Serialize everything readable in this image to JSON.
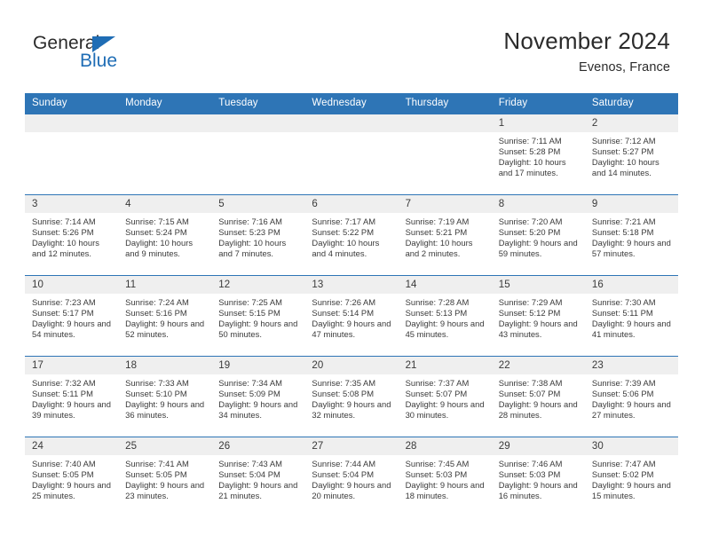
{
  "brand": {
    "name_part1": "General",
    "name_part2": "Blue",
    "logo_icon": "blue-triangle-icon"
  },
  "header": {
    "title": "November 2024",
    "location": "Evenos, France"
  },
  "colors": {
    "header_blue": "#2e75b6",
    "brand_blue": "#1f6db5",
    "daynum_band": "#efefef",
    "text": "#3a3a3a"
  },
  "weekday_headers": [
    "Sunday",
    "Monday",
    "Tuesday",
    "Wednesday",
    "Thursday",
    "Friday",
    "Saturday"
  ],
  "weeks": [
    [
      {
        "empty": true
      },
      {
        "empty": true
      },
      {
        "empty": true
      },
      {
        "empty": true
      },
      {
        "empty": true
      },
      {
        "day": "1",
        "sunrise": "Sunrise: 7:11 AM",
        "sunset": "Sunset: 5:28 PM",
        "daylight": "Daylight: 10 hours and 17 minutes."
      },
      {
        "day": "2",
        "sunrise": "Sunrise: 7:12 AM",
        "sunset": "Sunset: 5:27 PM",
        "daylight": "Daylight: 10 hours and 14 minutes."
      }
    ],
    [
      {
        "day": "3",
        "sunrise": "Sunrise: 7:14 AM",
        "sunset": "Sunset: 5:26 PM",
        "daylight": "Daylight: 10 hours and 12 minutes."
      },
      {
        "day": "4",
        "sunrise": "Sunrise: 7:15 AM",
        "sunset": "Sunset: 5:24 PM",
        "daylight": "Daylight: 10 hours and 9 minutes."
      },
      {
        "day": "5",
        "sunrise": "Sunrise: 7:16 AM",
        "sunset": "Sunset: 5:23 PM",
        "daylight": "Daylight: 10 hours and 7 minutes."
      },
      {
        "day": "6",
        "sunrise": "Sunrise: 7:17 AM",
        "sunset": "Sunset: 5:22 PM",
        "daylight": "Daylight: 10 hours and 4 minutes."
      },
      {
        "day": "7",
        "sunrise": "Sunrise: 7:19 AM",
        "sunset": "Sunset: 5:21 PM",
        "daylight": "Daylight: 10 hours and 2 minutes."
      },
      {
        "day": "8",
        "sunrise": "Sunrise: 7:20 AM",
        "sunset": "Sunset: 5:20 PM",
        "daylight": "Daylight: 9 hours and 59 minutes."
      },
      {
        "day": "9",
        "sunrise": "Sunrise: 7:21 AM",
        "sunset": "Sunset: 5:18 PM",
        "daylight": "Daylight: 9 hours and 57 minutes."
      }
    ],
    [
      {
        "day": "10",
        "sunrise": "Sunrise: 7:23 AM",
        "sunset": "Sunset: 5:17 PM",
        "daylight": "Daylight: 9 hours and 54 minutes."
      },
      {
        "day": "11",
        "sunrise": "Sunrise: 7:24 AM",
        "sunset": "Sunset: 5:16 PM",
        "daylight": "Daylight: 9 hours and 52 minutes."
      },
      {
        "day": "12",
        "sunrise": "Sunrise: 7:25 AM",
        "sunset": "Sunset: 5:15 PM",
        "daylight": "Daylight: 9 hours and 50 minutes."
      },
      {
        "day": "13",
        "sunrise": "Sunrise: 7:26 AM",
        "sunset": "Sunset: 5:14 PM",
        "daylight": "Daylight: 9 hours and 47 minutes."
      },
      {
        "day": "14",
        "sunrise": "Sunrise: 7:28 AM",
        "sunset": "Sunset: 5:13 PM",
        "daylight": "Daylight: 9 hours and 45 minutes."
      },
      {
        "day": "15",
        "sunrise": "Sunrise: 7:29 AM",
        "sunset": "Sunset: 5:12 PM",
        "daylight": "Daylight: 9 hours and 43 minutes."
      },
      {
        "day": "16",
        "sunrise": "Sunrise: 7:30 AM",
        "sunset": "Sunset: 5:11 PM",
        "daylight": "Daylight: 9 hours and 41 minutes."
      }
    ],
    [
      {
        "day": "17",
        "sunrise": "Sunrise: 7:32 AM",
        "sunset": "Sunset: 5:11 PM",
        "daylight": "Daylight: 9 hours and 39 minutes."
      },
      {
        "day": "18",
        "sunrise": "Sunrise: 7:33 AM",
        "sunset": "Sunset: 5:10 PM",
        "daylight": "Daylight: 9 hours and 36 minutes."
      },
      {
        "day": "19",
        "sunrise": "Sunrise: 7:34 AM",
        "sunset": "Sunset: 5:09 PM",
        "daylight": "Daylight: 9 hours and 34 minutes."
      },
      {
        "day": "20",
        "sunrise": "Sunrise: 7:35 AM",
        "sunset": "Sunset: 5:08 PM",
        "daylight": "Daylight: 9 hours and 32 minutes."
      },
      {
        "day": "21",
        "sunrise": "Sunrise: 7:37 AM",
        "sunset": "Sunset: 5:07 PM",
        "daylight": "Daylight: 9 hours and 30 minutes."
      },
      {
        "day": "22",
        "sunrise": "Sunrise: 7:38 AM",
        "sunset": "Sunset: 5:07 PM",
        "daylight": "Daylight: 9 hours and 28 minutes."
      },
      {
        "day": "23",
        "sunrise": "Sunrise: 7:39 AM",
        "sunset": "Sunset: 5:06 PM",
        "daylight": "Daylight: 9 hours and 27 minutes."
      }
    ],
    [
      {
        "day": "24",
        "sunrise": "Sunrise: 7:40 AM",
        "sunset": "Sunset: 5:05 PM",
        "daylight": "Daylight: 9 hours and 25 minutes."
      },
      {
        "day": "25",
        "sunrise": "Sunrise: 7:41 AM",
        "sunset": "Sunset: 5:05 PM",
        "daylight": "Daylight: 9 hours and 23 minutes."
      },
      {
        "day": "26",
        "sunrise": "Sunrise: 7:43 AM",
        "sunset": "Sunset: 5:04 PM",
        "daylight": "Daylight: 9 hours and 21 minutes."
      },
      {
        "day": "27",
        "sunrise": "Sunrise: 7:44 AM",
        "sunset": "Sunset: 5:04 PM",
        "daylight": "Daylight: 9 hours and 20 minutes."
      },
      {
        "day": "28",
        "sunrise": "Sunrise: 7:45 AM",
        "sunset": "Sunset: 5:03 PM",
        "daylight": "Daylight: 9 hours and 18 minutes."
      },
      {
        "day": "29",
        "sunrise": "Sunrise: 7:46 AM",
        "sunset": "Sunset: 5:03 PM",
        "daylight": "Daylight: 9 hours and 16 minutes."
      },
      {
        "day": "30",
        "sunrise": "Sunrise: 7:47 AM",
        "sunset": "Sunset: 5:02 PM",
        "daylight": "Daylight: 9 hours and 15 minutes."
      }
    ]
  ]
}
